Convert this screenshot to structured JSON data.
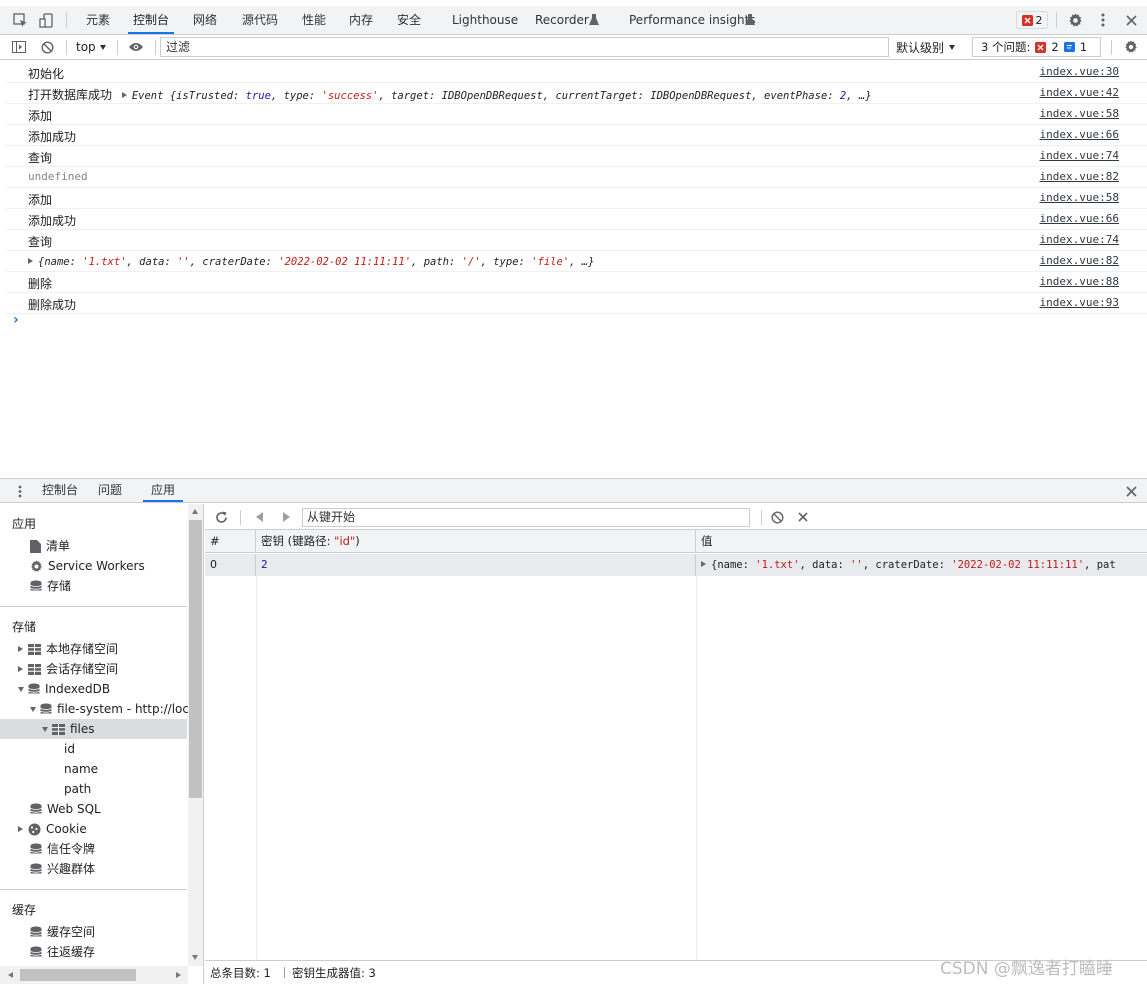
{
  "toolbar": {
    "tabs": [
      "元素",
      "控制台",
      "网络",
      "源代码",
      "性能",
      "内存",
      "安全",
      "Lighthouse",
      "Recorder",
      "Performance insights"
    ],
    "active_tab": "控制台",
    "error_count": "2"
  },
  "filter_bar": {
    "context": "top",
    "filter_placeholder": "过滤",
    "levels_label": "默认级别",
    "issues_label": "3 个问题:",
    "issues_errors": "2",
    "issues_info": "1"
  },
  "console": {
    "rows": [
      {
        "text": "初始化",
        "source": "index.vue:30"
      },
      {
        "text": "打开数据库成功",
        "source": "index.vue:42"
      },
      {
        "text": "添加",
        "source": "index.vue:58"
      },
      {
        "text": "添加成功",
        "source": "index.vue:66"
      },
      {
        "text": "查询",
        "source": "index.vue:74"
      },
      {
        "text": "undefined",
        "source": "index.vue:82"
      },
      {
        "text": "添加",
        "source": "index.vue:58"
      },
      {
        "text": "添加成功",
        "source": "index.vue:66"
      },
      {
        "text": "查询",
        "source": "index.vue:74"
      },
      {
        "text": "",
        "source": "index.vue:82"
      },
      {
        "text": "删除",
        "source": "index.vue:88"
      },
      {
        "text": "删除成功",
        "source": "index.vue:93"
      }
    ],
    "event_object": {
      "prefix": "Event {",
      "k1": "isTrusted: ",
      "v1": "true",
      "k2": ", type: ",
      "v2": "'success'",
      "k3": ", target: IDBOpenDBRequest, currentTarget: IDBOpenDBRequest, eventPhase: ",
      "v3": "2",
      "suffix": ", …}"
    },
    "file_object": {
      "k1": "{name: ",
      "v1": "'1.txt'",
      "k2": ", data: ",
      "v2": "''",
      "k3": ", craterDate: ",
      "v3": "'2022-02-02 11:11:11'",
      "k4": ", path: ",
      "v4": "'/'",
      "k5": ", type: ",
      "v5": "'file'",
      "suffix": ", …}"
    },
    "prompt": "›"
  },
  "drawer": {
    "tabs": [
      "控制台",
      "问题",
      "应用"
    ],
    "active_tab": "应用"
  },
  "sidebar": {
    "app_title": "应用",
    "app_items": [
      "清单",
      "Service Workers",
      "存储"
    ],
    "storage_title": "存储",
    "storage_items": [
      "本地存储空间",
      "会话存储空间",
      "IndexedDB",
      "file-system - http://local",
      "files",
      "id",
      "name",
      "path",
      "Web SQL",
      "Cookie",
      "信任令牌",
      "兴趣群体"
    ],
    "cache_title": "缓存",
    "cache_items": [
      "缓存空间",
      "往返缓存"
    ]
  },
  "idb": {
    "start_key_placeholder": "从键开始",
    "col_index": "#",
    "col_key_prefix": "密钥 (键路径: ",
    "col_key_path": "\"id\"",
    "col_key_suffix": ")",
    "col_value": "值",
    "row": {
      "index": "0",
      "key": "2",
      "v_k1": "{name: ",
      "v_v1": "'1.txt'",
      "v_k2": ", data: ",
      "v_v2": "''",
      "v_k3": ", craterDate: ",
      "v_v3": "'2022-02-02 11:11:11'",
      "v_k4": ", pat"
    },
    "status_total": "总条目数: 1",
    "status_keygen": "密钥生成器值: 3"
  },
  "watermark": "CSDN @飘逸者打瞌睡",
  "colors": {
    "accent": "#1a73e8",
    "error": "#d93025",
    "string": "#c41a16",
    "keyword": "#1a1aa6"
  }
}
